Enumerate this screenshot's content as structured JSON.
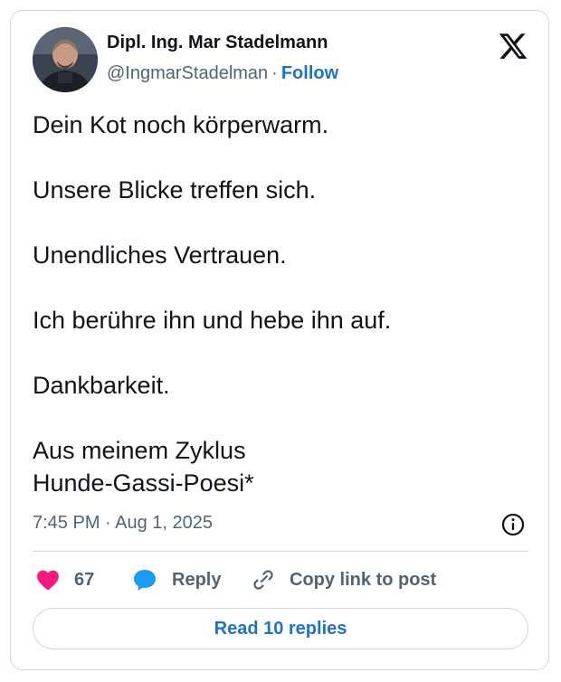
{
  "author": {
    "name": "Dipl. Ing. Mar Stadelmann",
    "handle": "@IngmarStadelman",
    "separator": "·",
    "follow_label": "Follow"
  },
  "tweet": {
    "lines": [
      "Dein Kot noch körperwarm.",
      "Unsere Blicke treffen sich.",
      "Unendliches Vertrauen.",
      "Ich berühre ihn und hebe ihn auf.",
      "Dankbarkeit.",
      "Aus meinem Zyklus",
      "Hunde-Gassi-Poesi*"
    ],
    "timestamp": "7:45 PM · Aug 1, 2025"
  },
  "actions": {
    "likes_count": "67",
    "reply_label": "Reply",
    "copy_label": "Copy link to post",
    "read_replies_label": "Read 10 replies"
  },
  "icons": {
    "platform": "x-logo-icon",
    "info": "info-icon",
    "like": "heart-icon",
    "reply": "speech-bubble-icon",
    "copy": "link-icon"
  },
  "colors": {
    "heart": "#f91880",
    "reply_bubble": "#1d9bf0",
    "follow_link": "#1d74c6",
    "secondary_text": "#536471",
    "border": "#cfd9de"
  }
}
